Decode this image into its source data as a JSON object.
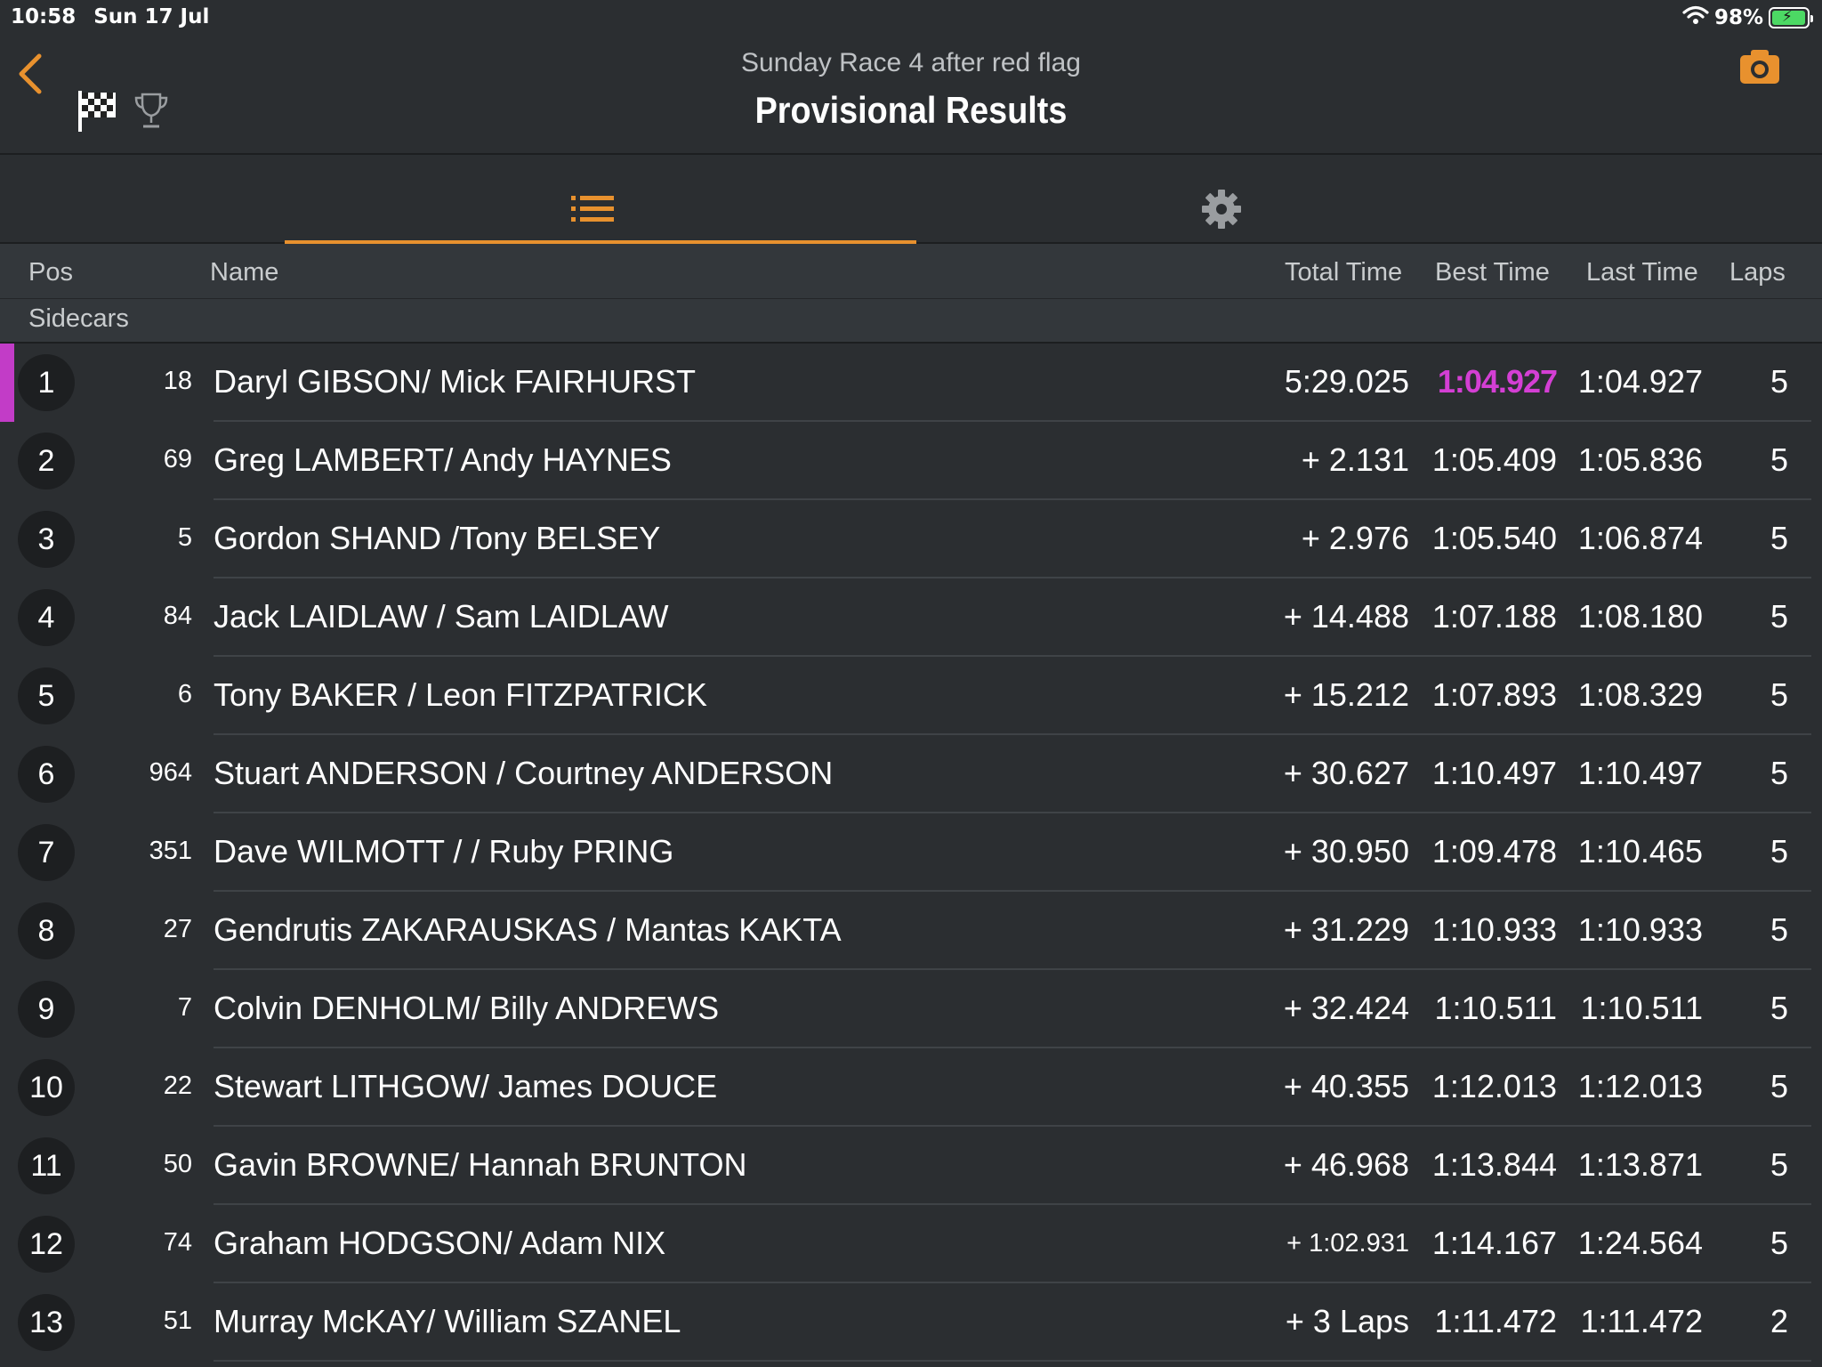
{
  "status_bar": {
    "time": "10:58",
    "date": "Sun 17 Jul",
    "battery": "98%",
    "battery_level": 0.98
  },
  "header": {
    "subtitle": "Sunday Race 4 after red flag",
    "title": "Provisional Results"
  },
  "columns": {
    "pos": "Pos",
    "name": "Name",
    "total_time": "Total Time",
    "best_time": "Best Time",
    "last_time": "Last Time",
    "laps": "Laps"
  },
  "section": "Sidecars",
  "colors": {
    "accent": "#e8912e",
    "fastest_lap": "#d43fd4",
    "leader_bar": "#c23cc7",
    "background": "#2b2e31"
  },
  "results": [
    {
      "pos": "1",
      "num": "18",
      "name": "Daryl GIBSON/ Mick FAIRHURST",
      "total": "5:29.025",
      "best": "1:04.927",
      "last": "1:04.927",
      "laps": "5"
    },
    {
      "pos": "2",
      "num": "69",
      "name": "Greg LAMBERT/ Andy HAYNES",
      "total": "+ 2.131",
      "best": "1:05.409",
      "last": "1:05.836",
      "laps": "5"
    },
    {
      "pos": "3",
      "num": "5",
      "name": "Gordon SHAND /Tony BELSEY",
      "total": "+ 2.976",
      "best": "1:05.540",
      "last": "1:06.874",
      "laps": "5"
    },
    {
      "pos": "4",
      "num": "84",
      "name": "Jack LAIDLAW / Sam LAIDLAW",
      "total": "+ 14.488",
      "best": "1:07.188",
      "last": "1:08.180",
      "laps": "5"
    },
    {
      "pos": "5",
      "num": "6",
      "name": "Tony BAKER / Leon FITZPATRICK",
      "total": "+ 15.212",
      "best": "1:07.893",
      "last": "1:08.329",
      "laps": "5"
    },
    {
      "pos": "6",
      "num": "964",
      "name": "Stuart ANDERSON / Courtney ANDERSON",
      "total": "+ 30.627",
      "best": "1:10.497",
      "last": "1:10.497",
      "laps": "5"
    },
    {
      "pos": "7",
      "num": "351",
      "name": "Dave WILMOTT / / Ruby PRING",
      "total": "+ 30.950",
      "best": "1:09.478",
      "last": "1:10.465",
      "laps": "5"
    },
    {
      "pos": "8",
      "num": "27",
      "name": "Gendrutis ZAKARAUSKAS / Mantas KAKTA",
      "total": "+ 31.229",
      "best": "1:10.933",
      "last": "1:10.933",
      "laps": "5"
    },
    {
      "pos": "9",
      "num": "7",
      "name": "Colvin DENHOLM/ Billy ANDREWS",
      "total": "+ 32.424",
      "best": "1:10.511",
      "last": "1:10.511",
      "laps": "5"
    },
    {
      "pos": "10",
      "num": "22",
      "name": "Stewart LITHGOW/ James DOUCE",
      "total": "+ 40.355",
      "best": "1:12.013",
      "last": "1:12.013",
      "laps": "5"
    },
    {
      "pos": "11",
      "num": "50",
      "name": "Gavin BROWNE/ Hannah BRUNTON",
      "total": "+ 46.968",
      "best": "1:13.844",
      "last": "1:13.871",
      "laps": "5"
    },
    {
      "pos": "12",
      "num": "74",
      "name": "Graham HODGSON/ Adam NIX",
      "total": "+ 1:02.931",
      "best": "1:14.167",
      "last": "1:24.564",
      "laps": "5"
    },
    {
      "pos": "13",
      "num": "51",
      "name": "Murray McKAY/ William SZANEL",
      "total": "+ 3 Laps",
      "best": "1:11.472",
      "last": "1:11.472",
      "laps": "2"
    }
  ]
}
